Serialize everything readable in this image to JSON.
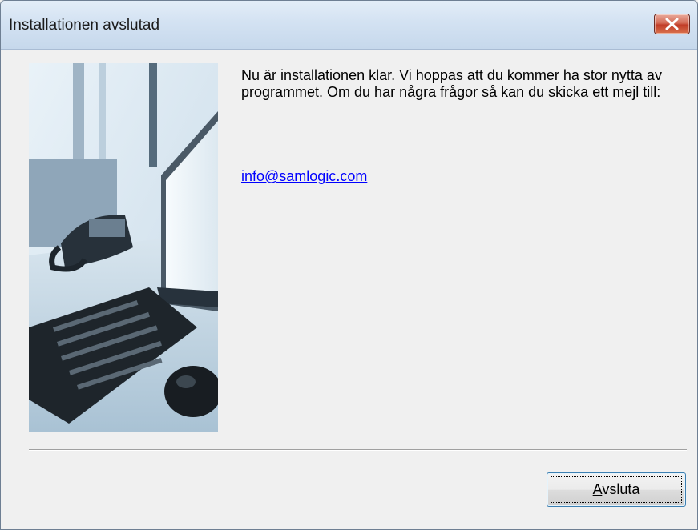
{
  "window": {
    "title": "Installationen avslutad",
    "close_icon": "close-icon"
  },
  "main": {
    "image": "office-desk-image",
    "message": "Nu är installationen klar. Vi hoppas att du kommer ha stor nytta av programmet. Om du har några frågor så kan du skicka ett mejl till:",
    "email": "info@samlogic.com"
  },
  "footer": {
    "finish_button": {
      "mnemonic": "A",
      "rest": "vsluta"
    }
  },
  "colors": {
    "link": "#0000ff",
    "close_button": "#c13c27",
    "background": "#f0f0f0"
  }
}
